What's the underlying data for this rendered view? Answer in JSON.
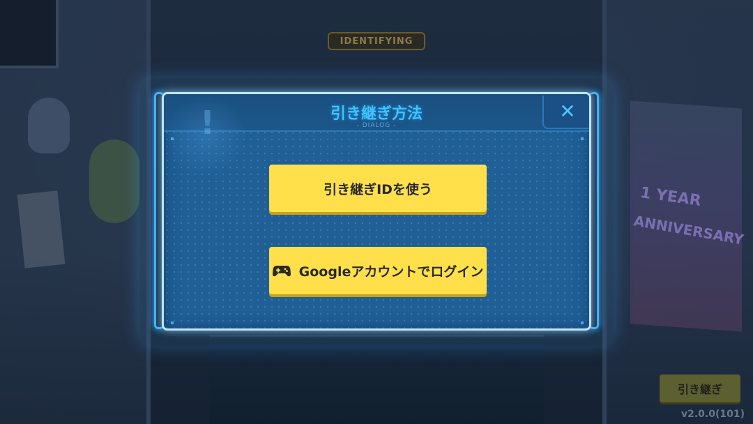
{
  "background": {
    "sign_text": "IDENTIFYING",
    "banner_year_text": "1 YEAR",
    "banner_anniversary_text": "ANNIVERSARY"
  },
  "dialog": {
    "title": "引き継ぎ方法",
    "subtitle": "- DIALOG -",
    "close_icon": "✕",
    "buttons": {
      "use_transfer_id": "引き継ぎIDを使う",
      "google_login": "Googleアカウントでログイン"
    }
  },
  "footer": {
    "transfer_button_label": "引き継ぎ",
    "version": "v2.0.0(101)"
  },
  "colors": {
    "dialog_bg": "#1f5f96",
    "title": "#3ec3ff",
    "button_yellow": "#ffe04a",
    "accent_glow": "#3ab2ff"
  },
  "icons": {
    "close": "close-icon",
    "google_button": "gamepad-icon"
  }
}
